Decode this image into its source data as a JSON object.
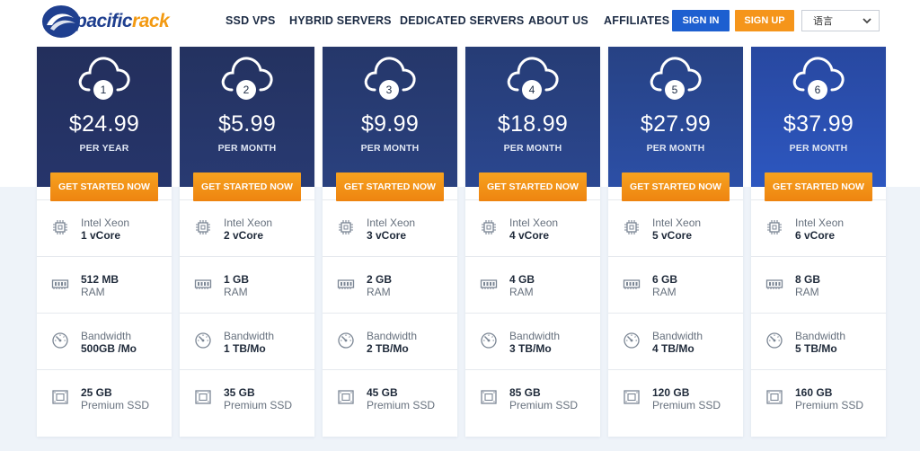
{
  "brand": {
    "name_part1": "pacific",
    "name_part2": "rack",
    "primary_color": "#1f3f8f",
    "accent_color": "#f39a12"
  },
  "nav": {
    "items": [
      "SSD VPS",
      "HYBRID SERVERS",
      "DEDICATED SERVERS",
      "ABOUT US",
      "AFFILIATES"
    ],
    "signin_label": "SIGN IN",
    "signup_label": "SIGN UP",
    "language_value": "语言"
  },
  "plans": [
    {
      "number": "1",
      "price": "$24.99",
      "period": "PER YEAR",
      "cta": "GET STARTED NOW",
      "cpu_line1": "Intel Xeon",
      "cpu_line2": "1 vCore",
      "ram_line1": "512 MB",
      "ram_line2": "RAM",
      "bw_line1": "Bandwidth",
      "bw_line2": "500GB /Mo",
      "disk_line1": "25 GB",
      "disk_line2": "Premium SSD",
      "gradient": [
        "#232f5c",
        "#26356b"
      ]
    },
    {
      "number": "2",
      "price": "$5.99",
      "period": "PER MONTH",
      "cta": "GET STARTED NOW",
      "cpu_line1": "Intel Xeon",
      "cpu_line2": "2 vCore",
      "ram_line1": "1 GB",
      "ram_line2": "RAM",
      "bw_line1": "Bandwidth",
      "bw_line2": "1 TB/Mo",
      "disk_line1": "35 GB",
      "disk_line2": "Premium SSD",
      "gradient": [
        "#243260",
        "#283a72"
      ]
    },
    {
      "number": "3",
      "price": "$9.99",
      "period": "PER MONTH",
      "cta": "GET STARTED NOW",
      "cpu_line1": "Intel Xeon",
      "cpu_line2": "3 vCore",
      "ram_line1": "2 GB",
      "ram_line2": "RAM",
      "bw_line1": "Bandwidth",
      "bw_line2": "2 TB/Mo",
      "disk_line1": "45 GB",
      "disk_line2": "Premium SSD",
      "gradient": [
        "#25376a",
        "#2a417f"
      ]
    },
    {
      "number": "4",
      "price": "$18.99",
      "period": "PER MONTH",
      "cta": "GET STARTED NOW",
      "cpu_line1": "Intel Xeon",
      "cpu_line2": "4 vCore",
      "ram_line1": "4 GB",
      "ram_line2": "RAM",
      "bw_line1": "Bandwidth",
      "bw_line2": "3 TB/Mo",
      "disk_line1": "85 GB",
      "disk_line2": "Premium SSD",
      "gradient": [
        "#263c75",
        "#2b4790"
      ]
    },
    {
      "number": "5",
      "price": "$27.99",
      "period": "PER MONTH",
      "cta": "GET STARTED NOW",
      "cpu_line1": "Intel Xeon",
      "cpu_line2": "5 vCore",
      "ram_line1": "6 GB",
      "ram_line2": "RAM",
      "bw_line1": "Bandwidth",
      "bw_line2": "4 TB/Mo",
      "disk_line1": "120 GB",
      "disk_line2": "Premium SSD",
      "gradient": [
        "#274284",
        "#2c4fa6"
      ]
    },
    {
      "number": "6",
      "price": "$37.99",
      "period": "PER MONTH",
      "cta": "GET STARTED NOW",
      "cpu_line1": "Intel Xeon",
      "cpu_line2": "6 vCore",
      "ram_line1": "8 GB",
      "ram_line2": "RAM",
      "bw_line1": "Bandwidth",
      "bw_line2": "5 TB/Mo",
      "disk_line1": "160 GB",
      "disk_line2": "Premium SSD",
      "gradient": [
        "#2848a0",
        "#2d57c0"
      ]
    }
  ],
  "icons": {
    "plan": "cloud-icon",
    "cpu": "cpu-chip-icon",
    "ram": "ram-module-icon",
    "bandwidth": "speedometer-icon",
    "disk": "hard-drive-icon",
    "language": "chevron-down-icon"
  }
}
